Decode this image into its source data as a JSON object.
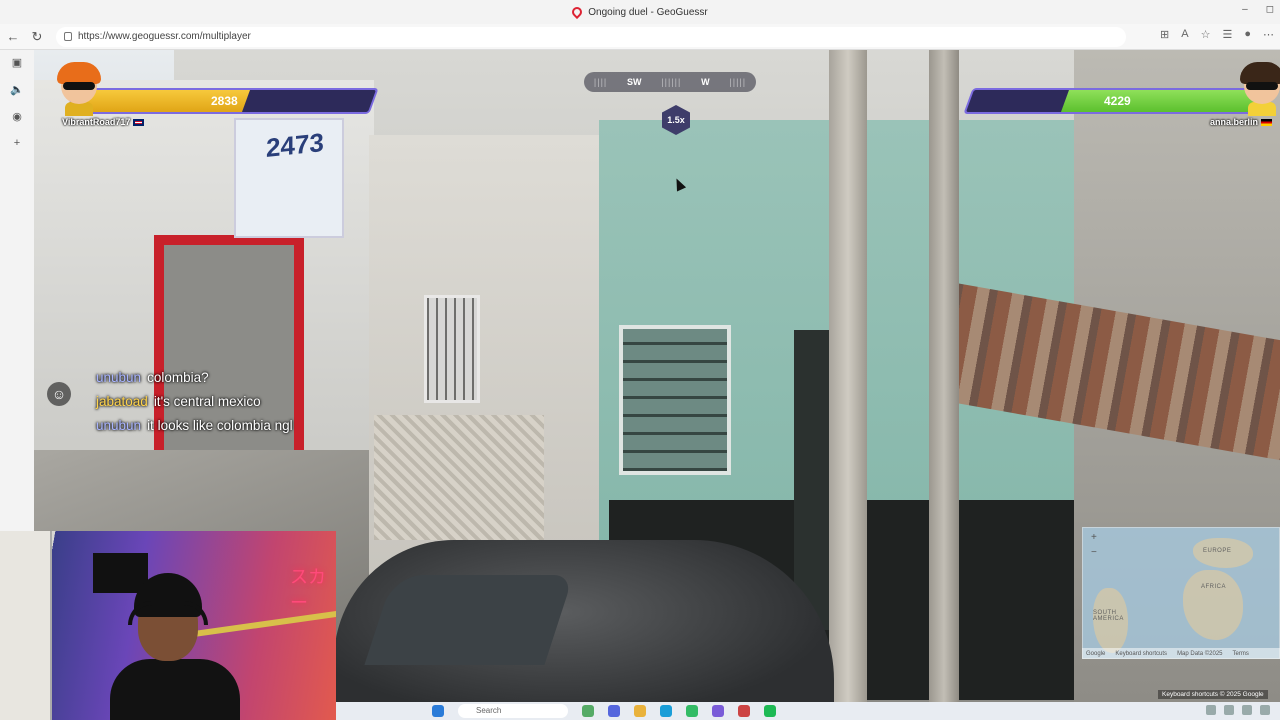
{
  "browser": {
    "tab_title": "Ongoing duel - GeoGuessr",
    "url": "https://www.geoguessr.com/multiplayer",
    "window_controls": [
      "–",
      "◻"
    ]
  },
  "hud": {
    "compass": {
      "left": "SW",
      "right": "W"
    },
    "multiplier": "1.5x",
    "player_left": {
      "name": "VibrantRoad717",
      "health": 2838,
      "health_fraction": 0.58,
      "flag": "uk-flag"
    },
    "player_right": {
      "name": "anna.berlin",
      "health": 4229,
      "health_fraction": 0.68,
      "flag": "germany-flag"
    }
  },
  "chat": [
    {
      "user": "unubun",
      "message": "colombia?",
      "color": "#a8b4ff"
    },
    {
      "user": "jabatoad",
      "message": "it's central mexico",
      "color": "#ffd34a"
    },
    {
      "user": "unubun",
      "message": "it looks like colombia ngl",
      "color": "#a8b4ff"
    }
  ],
  "minimap": {
    "labels": {
      "europe": "EUROPE",
      "africa": "AFRICA",
      "south_america": "SOUTH AMERICA"
    },
    "zoom_in": "+",
    "zoom_out": "−",
    "footer": {
      "shortcuts": "Keyboard shortcuts",
      "map_data": "Map Data ©2025",
      "terms": "Terms"
    },
    "google": "Google"
  },
  "streetview_footer": "Keyboard shortcuts  © 2025 Google",
  "webcam": {
    "neon": "スカー"
  },
  "taskbar": {
    "search": "Search"
  },
  "colors": {
    "left_bar": "#f7c93c",
    "right_bar": "#8fe05a",
    "bar_frame": "#7b6be0"
  }
}
